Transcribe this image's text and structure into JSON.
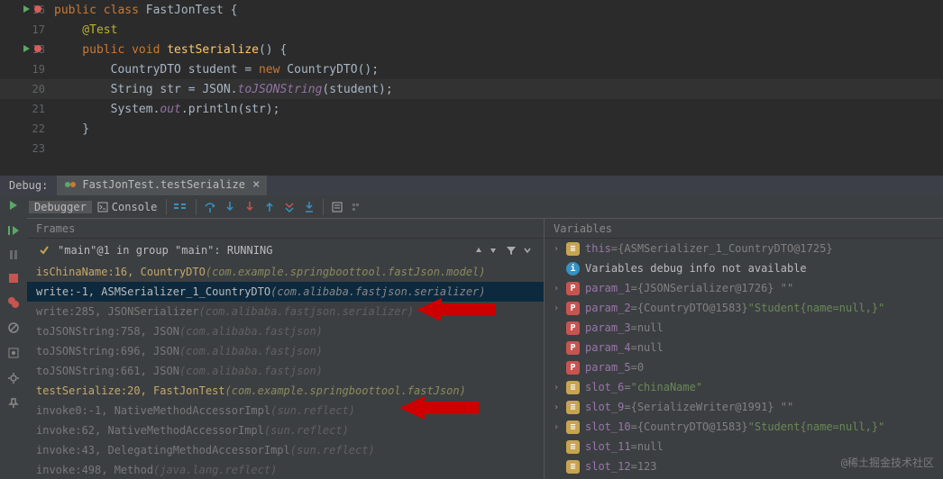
{
  "editor": {
    "lines": [
      {
        "num": 16,
        "marks": [
          "run",
          "bp"
        ],
        "tokens": [
          [
            "kw",
            "public class "
          ],
          [
            "ident",
            "FastJonTest "
          ],
          [
            "ident",
            "{"
          ]
        ]
      },
      {
        "num": 17,
        "tokens": [
          [
            "ann",
            "    @Test"
          ]
        ]
      },
      {
        "num": 18,
        "marks": [
          "run",
          "bp"
        ],
        "tokens": [
          [
            "kw",
            "    public void "
          ],
          [
            "method",
            "testSerialize"
          ],
          [
            "ident",
            "() {"
          ]
        ]
      },
      {
        "num": 19,
        "tokens": [
          [
            "ident",
            "        CountryDTO student = "
          ],
          [
            "kw",
            "new "
          ],
          [
            "ident",
            "CountryDTO();"
          ]
        ]
      },
      {
        "num": 20,
        "highlight": true,
        "tokens": [
          [
            "ident",
            "        String str = JSON."
          ],
          [
            "static-call",
            "toJSONString"
          ],
          [
            "ident",
            "(student);"
          ]
        ]
      },
      {
        "num": 21,
        "tokens": [
          [
            "ident",
            "        System."
          ],
          [
            "static-call",
            "out"
          ],
          [
            "ident",
            ".println(str);"
          ]
        ]
      },
      {
        "num": 22,
        "tokens": [
          [
            "ident",
            "    }"
          ]
        ]
      },
      {
        "num": 23,
        "tokens": [
          [
            "ident",
            ""
          ]
        ]
      }
    ]
  },
  "debug": {
    "label": "Debug:",
    "tab": "FastJonTest.testSerialize",
    "debugger_tab": "Debugger",
    "console_tab": "Console"
  },
  "frames": {
    "header": "Frames",
    "thread": "\"main\"@1 in group \"main\": RUNNING",
    "items": [
      {
        "style": "own",
        "text": "isChinaName:16, CountryDTO ",
        "pkg": "(com.example.springboottool.fastJson.model)"
      },
      {
        "style": "selected",
        "text": "write:-1, ASMSerializer_1_CountryDTO ",
        "pkg": "(com.alibaba.fastjson.serializer)"
      },
      {
        "style": "dim",
        "text": "write:285, JSONSerializer ",
        "pkg": "(com.alibaba.fastjson.serializer)"
      },
      {
        "style": "dim",
        "text": "toJSONString:758, JSON ",
        "pkg": "(com.alibaba.fastjson)"
      },
      {
        "style": "dim",
        "text": "toJSONString:696, JSON ",
        "pkg": "(com.alibaba.fastjson)"
      },
      {
        "style": "dim",
        "text": "toJSONString:661, JSON ",
        "pkg": "(com.alibaba.fastjson)"
      },
      {
        "style": "own",
        "text": "testSerialize:20, FastJonTest ",
        "pkg": "(com.example.springboottool.fastJson)"
      },
      {
        "style": "dim",
        "text": "invoke0:-1, NativeMethodAccessorImpl ",
        "pkg": "(sun.reflect)"
      },
      {
        "style": "dim",
        "text": "invoke:62, NativeMethodAccessorImpl ",
        "pkg": "(sun.reflect)"
      },
      {
        "style": "dim",
        "text": "invoke:43, DelegatingMethodAccessorImpl ",
        "pkg": "(sun.reflect)"
      },
      {
        "style": "dim",
        "text": "invoke:498, Method ",
        "pkg": "(java.lang.reflect)"
      }
    ]
  },
  "vars": {
    "header": "Variables",
    "items": [
      {
        "icon": "f",
        "chev": true,
        "name": "this",
        "eq": " = ",
        "val": "{ASMSerializer_1_CountryDTO@1725}"
      },
      {
        "icon": "i",
        "chev": false,
        "info": "Variables debug info not available"
      },
      {
        "icon": "p",
        "chev": true,
        "name": "param_1",
        "eq": " = ",
        "val": "{JSONSerializer@1726} \"\""
      },
      {
        "icon": "p",
        "chev": true,
        "name": "param_2",
        "eq": " = ",
        "val": "{CountryDTO@1583} ",
        "str": "\"Student{name=null,}\""
      },
      {
        "icon": "p",
        "chev": false,
        "name": "param_3",
        "eq": " = ",
        "val": "null"
      },
      {
        "icon": "p",
        "chev": false,
        "name": "param_4",
        "eq": " = ",
        "val": "null"
      },
      {
        "icon": "p",
        "chev": false,
        "name": "param_5",
        "eq": " = ",
        "val": "0"
      },
      {
        "icon": "f",
        "chev": true,
        "name": "slot_6",
        "eq": " = ",
        "str": "\"chinaName\""
      },
      {
        "icon": "f",
        "chev": true,
        "name": "slot_9",
        "eq": " = ",
        "val": "{SerializeWriter@1991} \"\""
      },
      {
        "icon": "f",
        "chev": true,
        "name": "slot_10",
        "eq": " = ",
        "val": "{CountryDTO@1583} ",
        "str": "\"Student{name=null,}\""
      },
      {
        "icon": "f",
        "chev": false,
        "name": "slot_11",
        "eq": " = ",
        "val": "null"
      },
      {
        "icon": "f",
        "chev": false,
        "name": "slot_12",
        "eq": " = ",
        "val": "123"
      }
    ]
  },
  "watermark": "@稀土掘金技术社区"
}
